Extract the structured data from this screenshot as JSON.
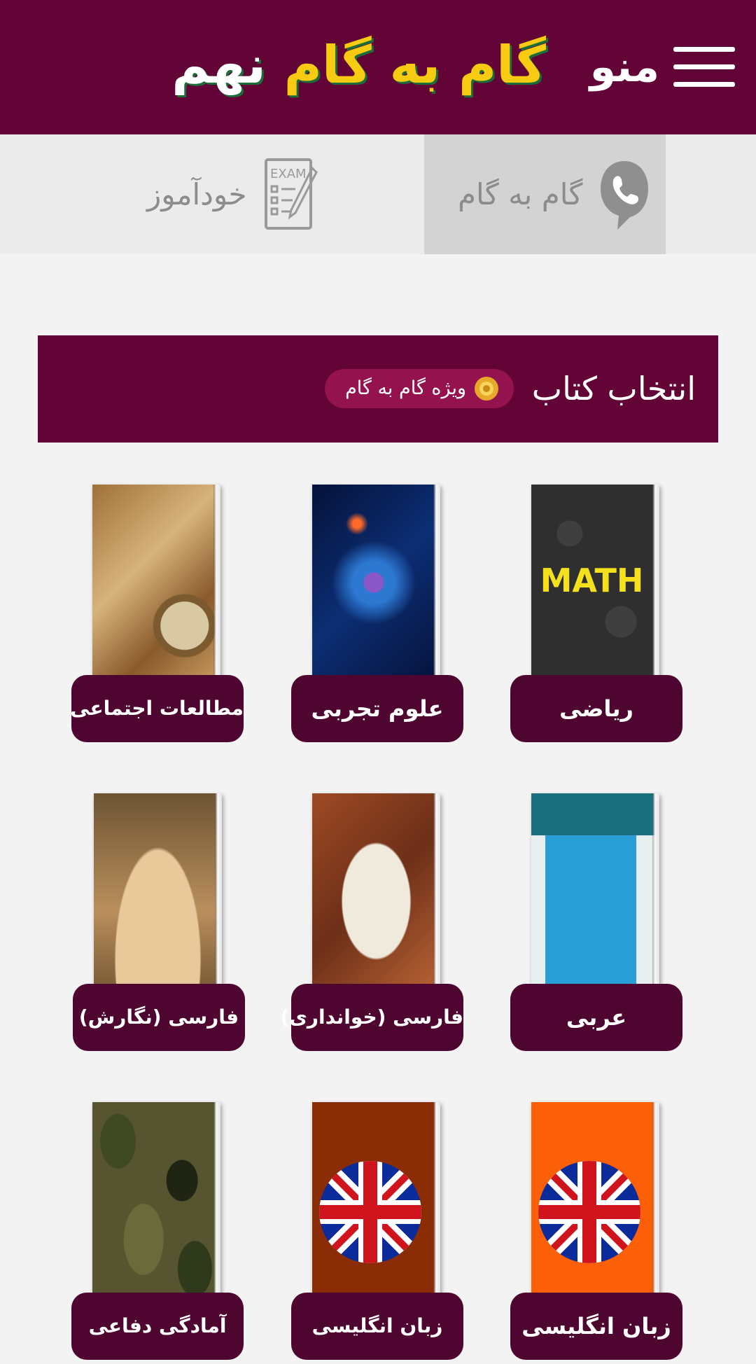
{
  "header": {
    "title_word_1": "گام",
    "title_word_2": "به",
    "title_word_3": "گام",
    "title_word_4": "نهم",
    "menu_label": "منو",
    "colors": {
      "bar": "#620436",
      "title_yellow": "#f6cb12"
    }
  },
  "tabs": [
    {
      "label": "گام به گام",
      "icon": "phone-icon",
      "active": true
    },
    {
      "label": "خودآموز",
      "icon": "exam-icon",
      "active": false
    }
  ],
  "section": {
    "title": "انتخاب کتاب",
    "badge": "ویژه گام به گام",
    "badge_icon": "medal-icon"
  },
  "books": [
    {
      "label": "ریاضی",
      "cover": "math-cover",
      "cover_text": "MATH"
    },
    {
      "label": "علوم تجربی",
      "cover": "neuron-cover"
    },
    {
      "label": "مطالعات اجتماعی",
      "cover": "compass-map-cover"
    },
    {
      "label": "عربی",
      "cover": "quran-language-cover"
    },
    {
      "label": "فارسی (خوانداری)",
      "cover": "statue-cover"
    },
    {
      "label": "فارسی (نگارش)",
      "cover": "open-book-cover"
    },
    {
      "label": "زبان انگلیسی",
      "cover": "uk-flag-orange-cover"
    },
    {
      "label": "زبان انگلیسی",
      "cover": "uk-flag-brown-cover"
    },
    {
      "label": "آمادگی دفاعی",
      "cover": "camouflage-cover"
    }
  ]
}
